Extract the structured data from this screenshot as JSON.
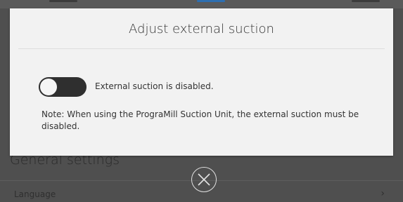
{
  "background": {
    "section_title": "General settings",
    "row_label": "Language",
    "row_chevron": "›"
  },
  "dialog": {
    "title": "Adjust external suction",
    "toggle_state": "off",
    "status_label": "External suction is disabled.",
    "note": "Note: When using the PrograMill Suction Unit, the external suction must be disabled."
  },
  "close_icon": "close-circle-icon",
  "colors": {
    "overlay": "#4f4f4f",
    "dialog": "#f2f2f2",
    "toggle_track": "#2f2f2f",
    "toggle_knob": "#f5f5f5"
  }
}
